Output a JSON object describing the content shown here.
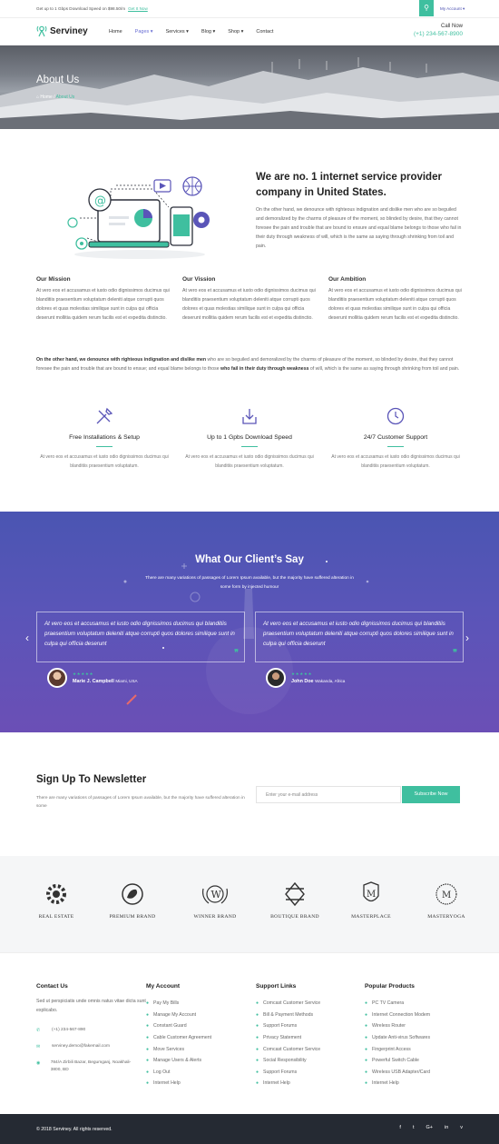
{
  "topbar": {
    "promo": "Get up to 1 Gbps Download Speed on $98.50/m",
    "promo_link": "Get It Now",
    "account": "My Account ▾"
  },
  "header": {
    "brand": "Serviney",
    "nav": [
      "Home",
      "Pages ▾",
      "Services ▾",
      "Blog ▾",
      "Shop ▾",
      "Contact"
    ],
    "call_label": "Call Now",
    "call_number": "(+1) 234-567-8900"
  },
  "banner": {
    "title": "About Us",
    "crumb_home": "Home",
    "crumb_sep": "/",
    "crumb_current": "About Us"
  },
  "about": {
    "heading": "We are no. 1 internet service provider company in United States.",
    "lead": "On the other hand, we denounce with righteous indignation and dislike men who are so beguiled and demoralized by the charms of pleasure of the moment, so blinded by desire, that they cannot foresee the pain and trouble that are bound to ensure and equal blame belongs to those who fail in their duty through weakness of will, which is the same as saying through shrinking from toil and pain.",
    "columns": [
      {
        "title": "Our Mission",
        "text": "At vero eos et accusamus et iusto odio dignissimos ducimus qui blanditiis praesentium voluptatum deleniti atque corrupti quos dolores et quas molestias similique sunt in culpa qui officia deserunt mollitia quidem rerum facilis est et expedita distinctio."
      },
      {
        "title": "Our Vission",
        "text": "At vero eos et accusamus et iusto odio dignissimos ducimus qui blanditiis praesentium voluptatum deleniti atque corrupti quos dolores et quas molestias similique sunt in culpa qui officia deserunt mollitia quidem rerum facilis est et expedita distinctio."
      },
      {
        "title": "Our Ambition",
        "text": "At vero eos et accusamus et iusto odio dignissimos ducimus qui blanditiis praesentium voluptatum deleniti atque corrupti quos dolores et quas molestias similique sunt in culpa qui officia deserunt mollitia quidem rerum facilis est et expedita distinctio."
      }
    ],
    "para_b1": "On the other hand, we denounce with righteous indignation and dislike men",
    "para_t1": " who are so beguiled and demoralized by the charms of pleasure of the moment, so blinded by desire, that they cannot foresee the pain and trouble that are bound to ensue; and equal blame belongs to those ",
    "para_b2": "who fail in their duty through weakness",
    "para_t2": " of will, which is the same as saying through shrinking from toil and pain."
  },
  "features": [
    {
      "title": "Free Installations & Setup",
      "text": "At vero eos et accusamus et iusto odio dignissimos ducimus qui blanditiis praesentium voluptatum."
    },
    {
      "title": "Up to 1 Gpbs Download Speed",
      "text": "At vero eos et accusamus et iusto odio dignissimos ducimus qui blanditiis praesentium voluptatum."
    },
    {
      "title": "24/7 Customer Support",
      "text": "At vero eos et accusamus et iusto odio dignissimos ducimus qui blanditiis praesentium voluptatum."
    }
  ],
  "testimonials": {
    "title": "What Our Client’s Say",
    "subtitle": "There are many variations of passages of Lorem Ipsum available, but the majority have suffered alteration in some form by injected humour",
    "items": [
      {
        "quote": "At vero eos et accusamus et iusto odio dignissimos ducimus qui blanditiis praesentium voluptatum deleniti atque corrupti quos dolores similique sunt in culpa qui officia deserunt",
        "name": "Marie J. Campbell",
        "location": "Miami, USA",
        "stars": "★★★★★"
      },
      {
        "quote": "At vero eos et accusamus et iusto odio dignissimos ducimus qui blanditiis praesentium voluptatum deleniti atque corrupti quos dolores similique sunt in culpa qui officia deserunt",
        "name": "John Doe",
        "location": "Wakanda, Africa",
        "stars": "★★★★★"
      }
    ],
    "quote_mark": "❞",
    "prev": "‹",
    "next": "›"
  },
  "newsletter": {
    "title": "Sign Up To Newsletter",
    "subtitle": "There are many variations of passages of Lorem Ipsum available, but the majority have suffered alteration in some",
    "placeholder": "Enter your e-mail address",
    "button": "Subscribe Now"
  },
  "brands": [
    "REAL ESTATE",
    "PREMIUM BRAND",
    "WINNER BRAND",
    "BOUTIQUE BRAND",
    "MASTERPLACE",
    "MASTERYOGA"
  ],
  "footer": {
    "contact": {
      "title": "Contact Us",
      "about": "Sed ut perspiciatis unde omnis natus vitae dicta sunt explicabo.",
      "phone": "(+1) 234-567-890",
      "email": "serviney.demo@fakemail.com",
      "address": "784/A Zirbili Bazar, Begumganj, Noakhali-3800, BD"
    },
    "account": {
      "title": "My Account",
      "items": [
        "Pay My Bills",
        "Manage My Account",
        "Constant Guard",
        "Cable Customer Agreement",
        "Move Services",
        "Manage Users & Alerts",
        "Log Out",
        "Internet Help"
      ]
    },
    "support": {
      "title": "Support Links",
      "items": [
        "Comcast Customer Service",
        "Bill & Payment Methods",
        "Support Forums",
        "Privacy Statement",
        "Comcast Customer Service",
        "Social Responsibility",
        "Support Forums",
        "Internet Help"
      ]
    },
    "products": {
      "title": "Popular Products",
      "items": [
        "PC TV Camera",
        "Internet Connection Modem",
        "Wireless Router",
        "Update Anti-virus Softwares",
        "Fingerprint Access",
        "Powerful Switch Cable",
        "Wireless USB Adapter/Card",
        "Internet Help"
      ]
    }
  },
  "bottom": {
    "copyright": "© 2018 Serviney. All rights reserved.",
    "social": [
      "f",
      "t",
      "G+",
      "in",
      "v"
    ]
  },
  "colors": {
    "accent": "#3fbf9f",
    "purple": "#5a55b8",
    "dark": "#252a33"
  }
}
